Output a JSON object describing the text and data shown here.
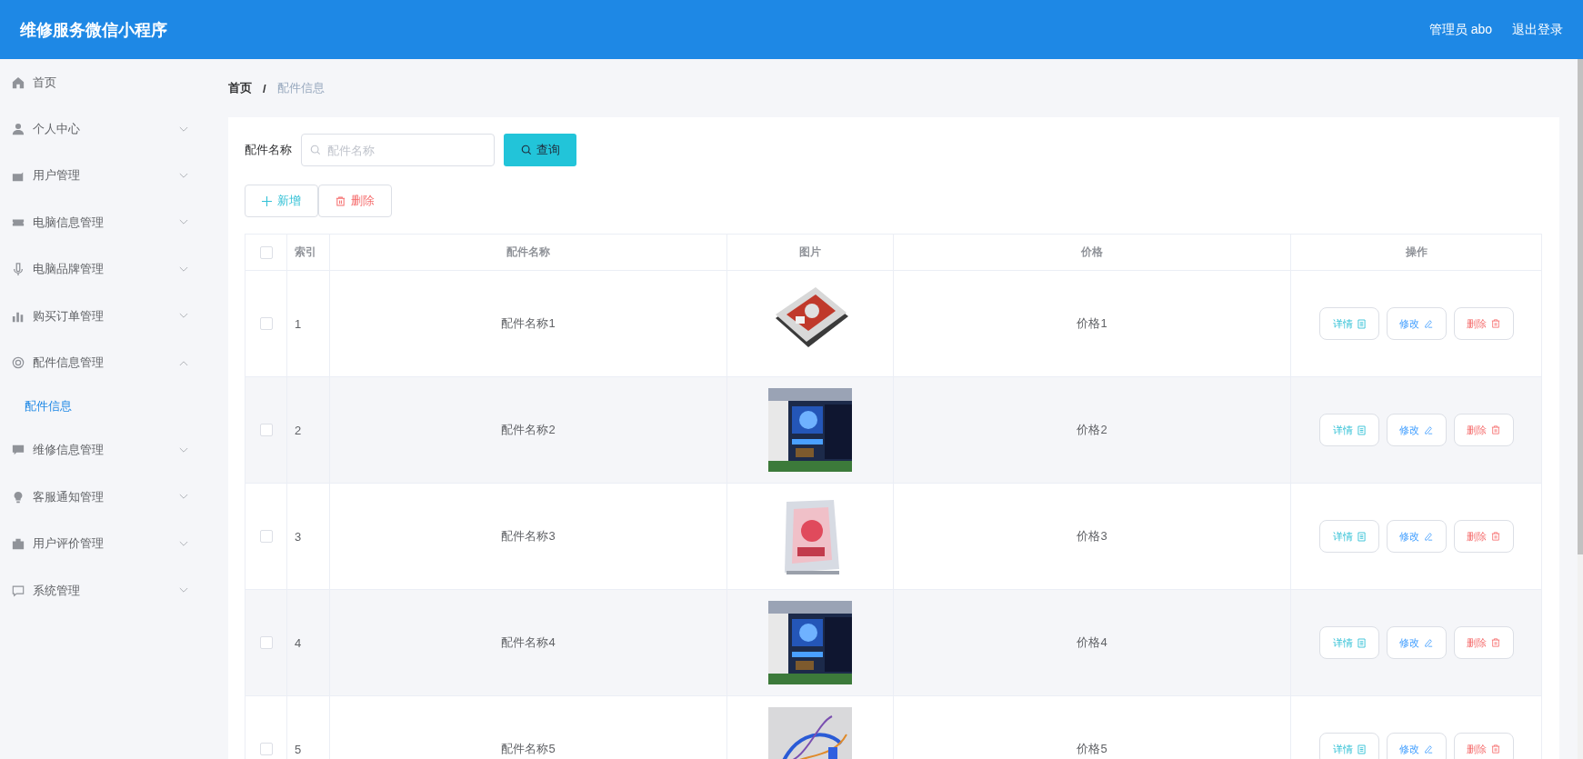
{
  "header": {
    "title": "维修服务微信小程序",
    "user": "管理员 abo",
    "logout": "退出登录"
  },
  "sidebar": {
    "items": [
      {
        "label": "首页"
      },
      {
        "label": "个人中心",
        "expanded": false
      },
      {
        "label": "用户管理",
        "expanded": false
      },
      {
        "label": "电脑信息管理",
        "expanded": false
      },
      {
        "label": "电脑品牌管理",
        "expanded": false
      },
      {
        "label": "购买订单管理",
        "expanded": false
      },
      {
        "label": "配件信息管理",
        "expanded": true,
        "children": [
          {
            "label": "配件信息",
            "selected": true
          }
        ]
      },
      {
        "label": "维修信息管理",
        "expanded": false
      },
      {
        "label": "客服通知管理",
        "expanded": false
      },
      {
        "label": "用户评价管理",
        "expanded": false
      },
      {
        "label": "系统管理",
        "expanded": false
      }
    ]
  },
  "breadcrumb": {
    "items": [
      {
        "label": "首页",
        "current": false
      },
      {
        "label": "配件信息",
        "current": true
      }
    ],
    "separator": "/"
  },
  "search": {
    "label": "配件名称",
    "placeholder": "配件名称",
    "button": "查询"
  },
  "actions": {
    "add": "新增",
    "delete": "删除"
  },
  "table": {
    "select_all": false,
    "columns": [
      "索引",
      "配件名称",
      "图片",
      "价格",
      "操作"
    ],
    "rows": [
      {
        "index": "1",
        "name": "配件名称1",
        "price": "价格1",
        "checked": false,
        "kind": "picture",
        "actions": [
          "详情",
          "修改",
          "删除"
        ]
      },
      {
        "index": "2",
        "name": "配件名称2",
        "price": "价格2",
        "checked": false,
        "kind": "picture",
        "actions": [
          "详情",
          "修改",
          "删除"
        ]
      },
      {
        "index": "3",
        "name": "配件名称3",
        "price": "价格3",
        "checked": false,
        "kind": "picture",
        "actions": [
          "详情",
          "修改",
          "删除"
        ]
      },
      {
        "index": "4",
        "name": "配件名称4",
        "price": "价格4",
        "checked": false,
        "kind": "picture",
        "actions": [
          "详情",
          "修改",
          "删除"
        ]
      },
      {
        "index": "5",
        "name": "配件名称5",
        "price": "价格5",
        "checked": false,
        "kind": "picture",
        "actions": [
          "详情",
          "修改",
          "删除"
        ]
      }
    ]
  }
}
